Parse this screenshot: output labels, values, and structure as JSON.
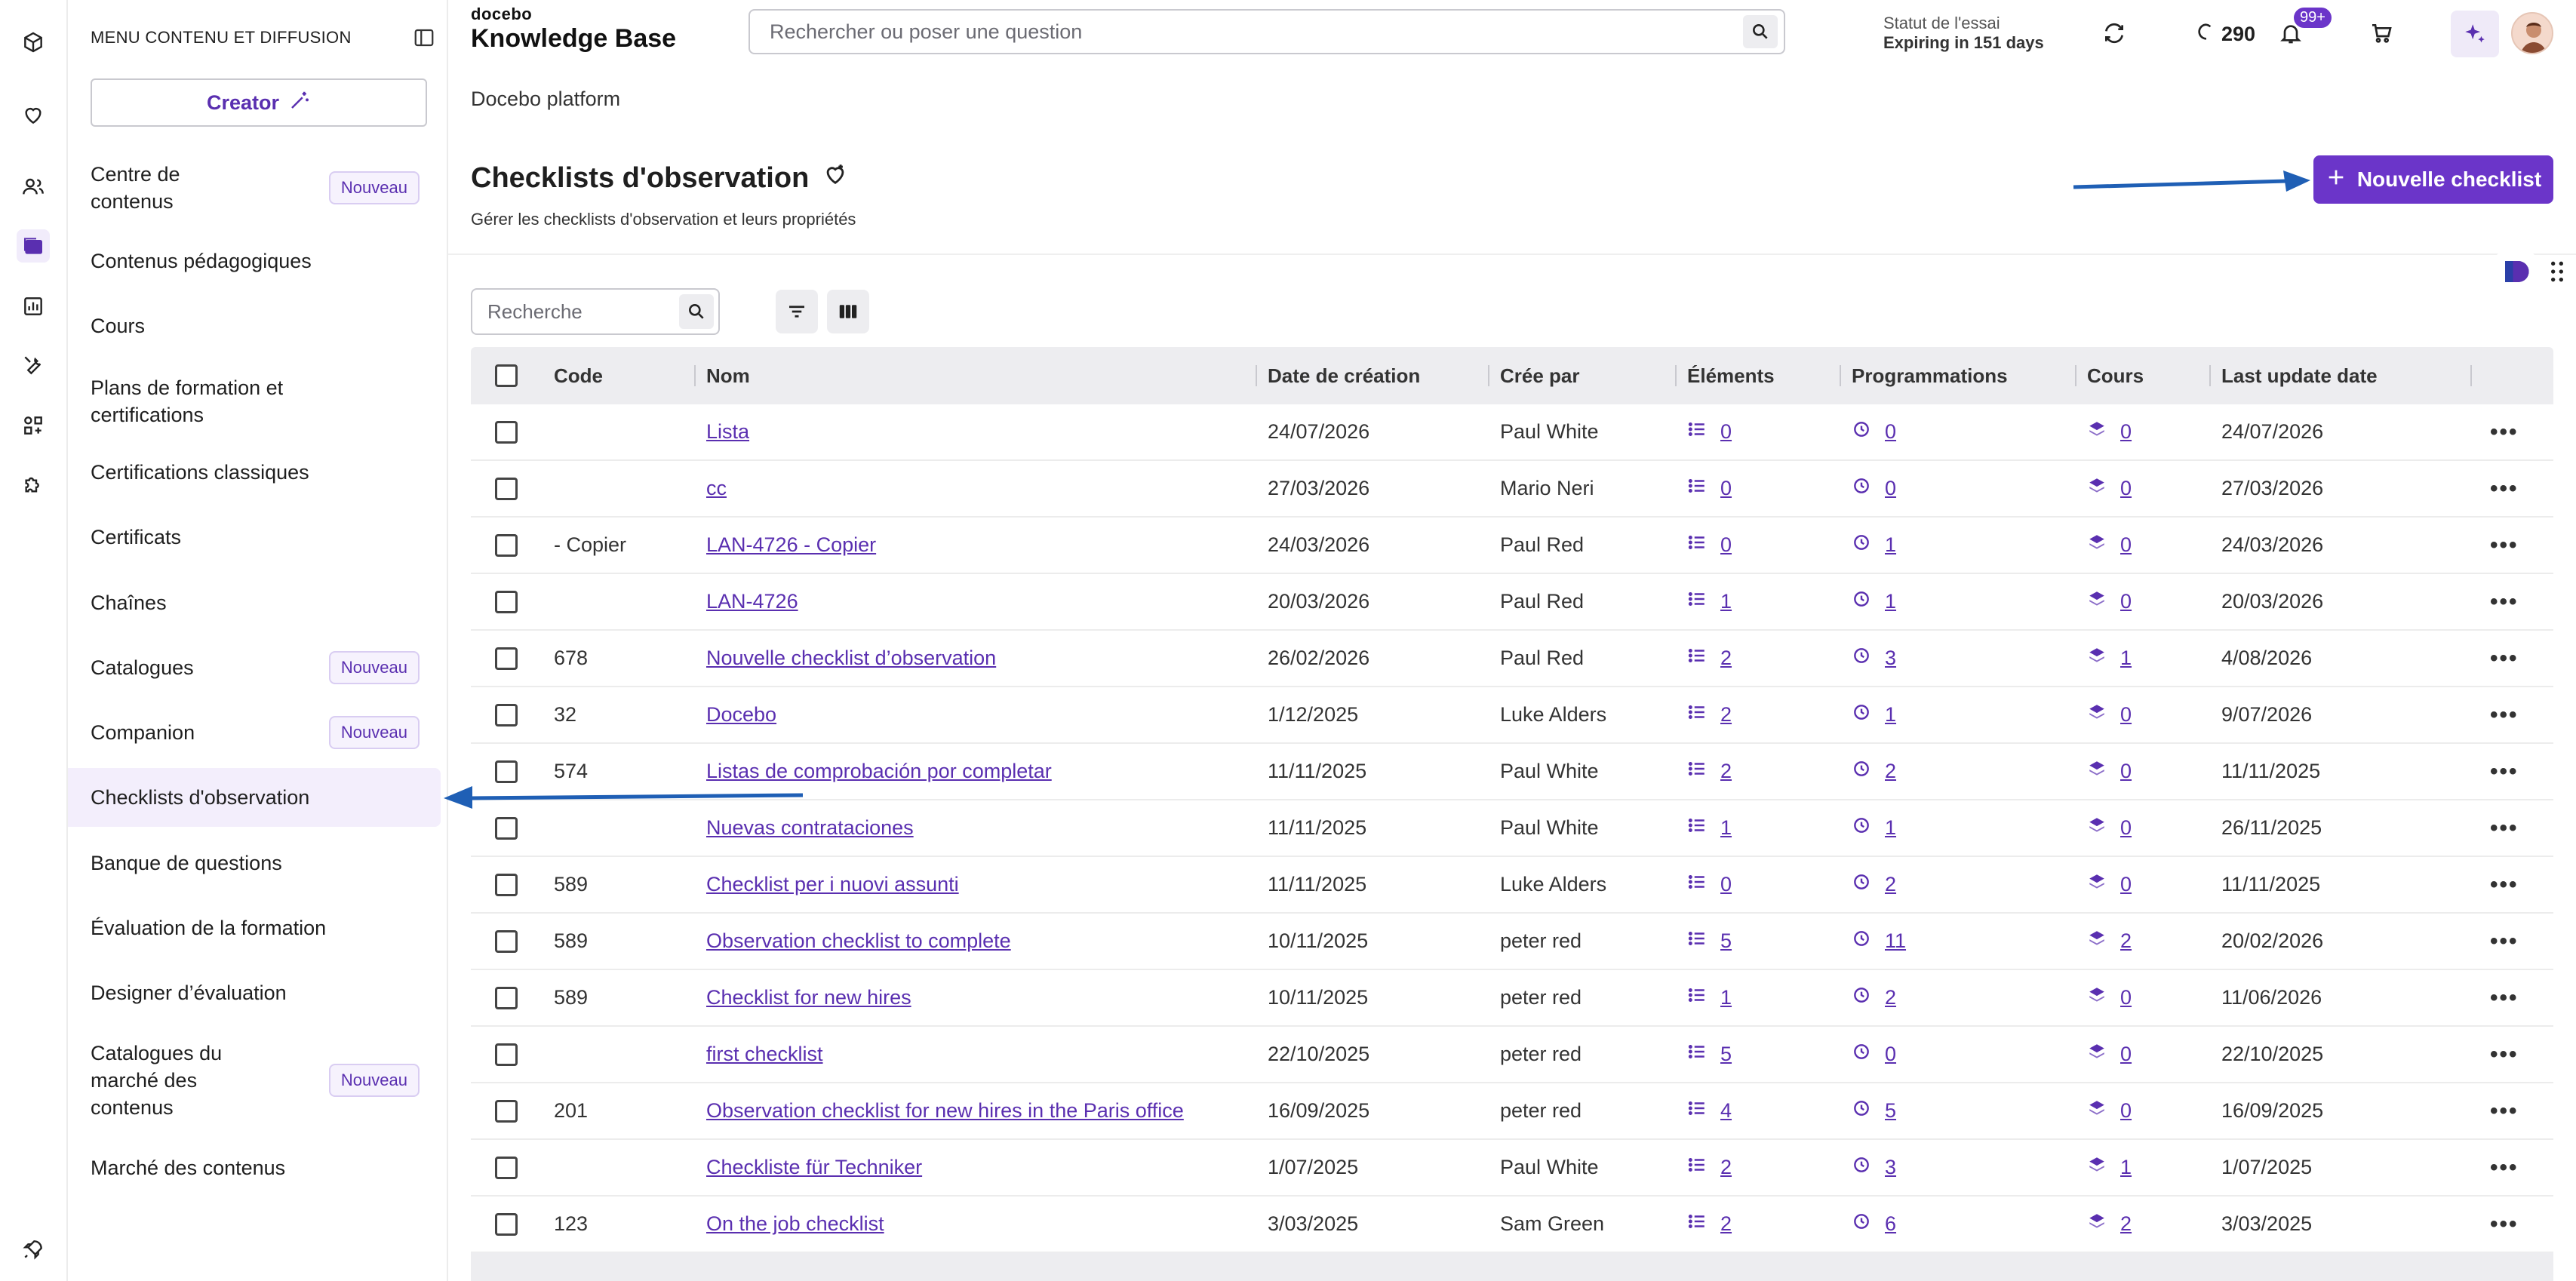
{
  "rail": {
    "items": [
      "cube-icon",
      "heart-icon",
      "users-icon",
      "content-icon",
      "reports-icon",
      "tools-icon",
      "apps-icon",
      "puzzle-icon",
      "rocket-icon"
    ]
  },
  "menu": {
    "title": "MENU CONTENU ET DIFFUSION",
    "creator_label": "Creator",
    "new_badge": "Nouveau",
    "items": [
      {
        "label": "Centre de contenus",
        "badge": "Nouveau"
      },
      {
        "label": "Contenus pédagogiques"
      },
      {
        "label": "Cours"
      },
      {
        "label": "Plans de formation et certifications"
      },
      {
        "label": "Certifications classiques"
      },
      {
        "label": "Certificats"
      },
      {
        "label": "Chaînes"
      },
      {
        "label": "Catalogues",
        "badge": "Nouveau"
      },
      {
        "label": "Companion",
        "badge": "Nouveau"
      },
      {
        "label": "Checklists d'observation",
        "active": true
      },
      {
        "label": "Banque de questions"
      },
      {
        "label": "Évaluation de la formation"
      },
      {
        "label": "Designer d’évaluation"
      },
      {
        "label": "Catalogues du marché des contenus",
        "badge": "Nouveau"
      },
      {
        "label": "Marché des contenus"
      }
    ]
  },
  "topbar": {
    "logo_small": "docebo",
    "logo_big": "Knowledge Base",
    "search_placeholder": "Rechercher ou poser une question",
    "trial_label": "Statut de l'essai",
    "trial_value": "Expiring in 151 days",
    "credits": "290",
    "notifications": "99+"
  },
  "page": {
    "breadcrumb": "Docebo platform",
    "title": "Checklists d'observation",
    "subtitle": "Gérer les checklists d'observation et leurs propriétés",
    "new_button": "Nouvelle checklist",
    "search_placeholder": "Recherche"
  },
  "table": {
    "columns": [
      "Code",
      "Nom",
      "Date de création",
      "Crée par",
      "Éléments",
      "Programmations",
      "Cours",
      "Last update date"
    ],
    "rows": [
      {
        "code": "",
        "name": "Lista",
        "created": "24/07/2026",
        "by": "Paul White",
        "elements": "0",
        "schedules": "0",
        "courses": "0",
        "updated": "24/07/2026"
      },
      {
        "code": "",
        "name": "cc",
        "created": "27/03/2026",
        "by": "Mario Neri",
        "elements": "0",
        "schedules": "0",
        "courses": "0",
        "updated": "27/03/2026"
      },
      {
        "code": "- Copier",
        "name": "LAN-4726 - Copier",
        "created": "24/03/2026",
        "by": "Paul Red",
        "elements": "0",
        "schedules": "1",
        "courses": "0",
        "updated": "24/03/2026"
      },
      {
        "code": "",
        "name": "LAN-4726",
        "created": "20/03/2026",
        "by": "Paul Red",
        "elements": "1",
        "schedules": "1",
        "courses": "0",
        "updated": "20/03/2026"
      },
      {
        "code": "678",
        "name": "Nouvelle checklist d’observation",
        "created": "26/02/2026",
        "by": "Paul Red",
        "elements": "2",
        "schedules": "3",
        "courses": "1",
        "updated": "4/08/2026"
      },
      {
        "code": "32",
        "name": "Docebo",
        "created": "1/12/2025",
        "by": "Luke Alders",
        "elements": "2",
        "schedules": "1",
        "courses": "0",
        "updated": "9/07/2026"
      },
      {
        "code": "574",
        "name": "Listas de comprobación por completar",
        "created": "11/11/2025",
        "by": "Paul White",
        "elements": "2",
        "schedules": "2",
        "courses": "0",
        "updated": "11/11/2025"
      },
      {
        "code": "",
        "name": "Nuevas contrataciones",
        "created": "11/11/2025",
        "by": "Paul White",
        "elements": "1",
        "schedules": "1",
        "courses": "0",
        "updated": "26/11/2025"
      },
      {
        "code": "589",
        "name": "Checklist per i nuovi assunti",
        "created": "11/11/2025",
        "by": "Luke Alders",
        "elements": "0",
        "schedules": "2",
        "courses": "0",
        "updated": "11/11/2025"
      },
      {
        "code": "589",
        "name": "Observation checklist to complete",
        "created": "10/11/2025",
        "by": "peter red",
        "elements": "5",
        "schedules": "11",
        "courses": "2",
        "updated": "20/02/2026"
      },
      {
        "code": "589",
        "name": "Checklist for new hires",
        "created": "10/11/2025",
        "by": "peter red",
        "elements": "1",
        "schedules": "2",
        "courses": "0",
        "updated": "11/06/2026"
      },
      {
        "code": "",
        "name": "first checklist",
        "created": "22/10/2025",
        "by": "peter red",
        "elements": "5",
        "schedules": "0",
        "courses": "0",
        "updated": "22/10/2025"
      },
      {
        "code": "201",
        "name": "Observation checklist for new hires in the Paris office",
        "created": "16/09/2025",
        "by": "peter red",
        "elements": "4",
        "schedules": "5",
        "courses": "0",
        "updated": "16/09/2025"
      },
      {
        "code": "",
        "name": "Checkliste für Techniker",
        "created": "1/07/2025",
        "by": "Paul White",
        "elements": "2",
        "schedules": "3",
        "courses": "1",
        "updated": "1/07/2025"
      },
      {
        "code": "123",
        "name": "On the job checklist",
        "created": "3/03/2025",
        "by": "Sam Green",
        "elements": "2",
        "schedules": "6",
        "courses": "2",
        "updated": "3/03/2025"
      }
    ]
  },
  "colors": {
    "accent": "#6b35c9",
    "link": "#5a2fb0",
    "arrow": "#1f5fb5",
    "header_bg": "#ededf0"
  }
}
